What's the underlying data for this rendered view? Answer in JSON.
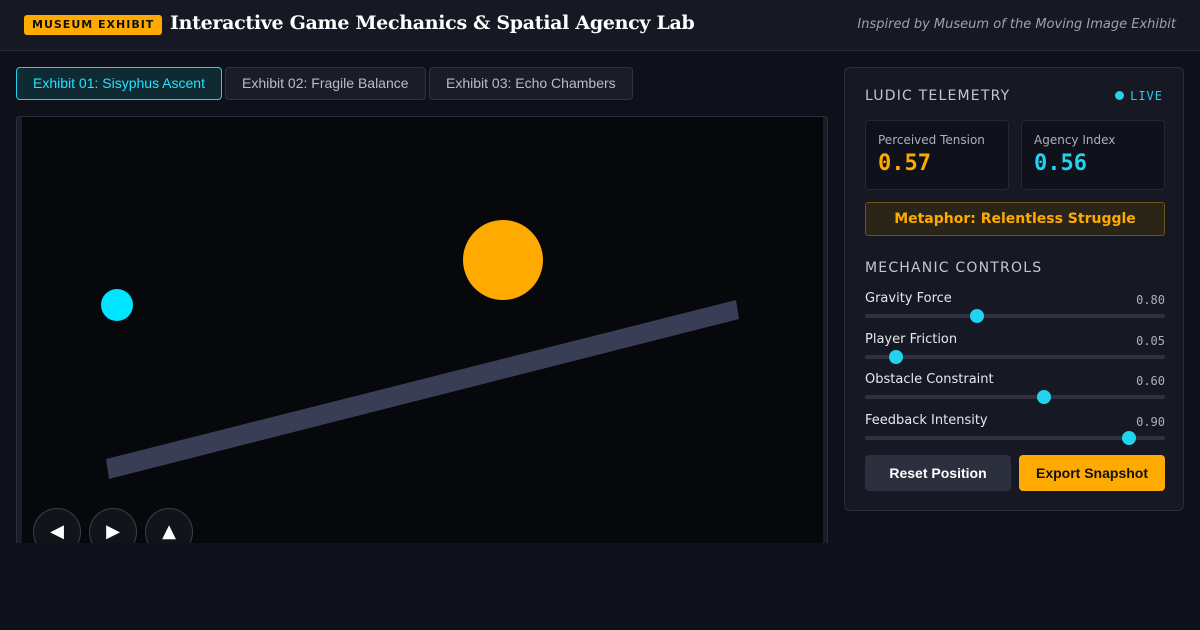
{
  "header": {
    "badge": "MUSEUM EXHIBIT",
    "title": "Interactive Game Mechanics & Spatial Agency Lab",
    "subtitle": "Inspired by Museum of the Moving Image Exhibit"
  },
  "tabs": [
    {
      "label": "Exhibit 01: Sisyphus Ascent",
      "active": true
    },
    {
      "label": "Exhibit 02: Fragile Balance",
      "active": false
    },
    {
      "label": "Exhibit 03: Echo Chambers",
      "active": false
    }
  ],
  "controls": {
    "left_icon": "◀",
    "right_icon": "▶",
    "up_icon": "▲"
  },
  "telemetry": {
    "heading": "LUDIC TELEMETRY",
    "live_label": "LIVE",
    "metrics": [
      {
        "label": "Perceived Tension",
        "value": "0.57",
        "color": "#ffaa00"
      },
      {
        "label": "Agency Index",
        "value": "0.56",
        "color": "#22d3ee"
      }
    ],
    "metaphor": "Metaphor: Relentless Struggle"
  },
  "mechanics": {
    "heading": "MECHANIC CONTROLS",
    "sliders": [
      {
        "label": "Gravity Force",
        "value": "0.80",
        "level": 0.373
      },
      {
        "label": "Player Friction",
        "value": "0.05",
        "level": 0.103
      },
      {
        "label": "Obstacle Constraint",
        "value": "0.60",
        "level": 0.597
      },
      {
        "label": "Feedback Intensity",
        "value": "0.90",
        "level": 0.88
      }
    ]
  },
  "actions": {
    "reset_label": "Reset Position",
    "export_label": "Export Snapshot"
  },
  "colors": {
    "accent_cyan": "#22d3ee",
    "accent_orange": "#ffaa00",
    "background": "#0e111a"
  }
}
